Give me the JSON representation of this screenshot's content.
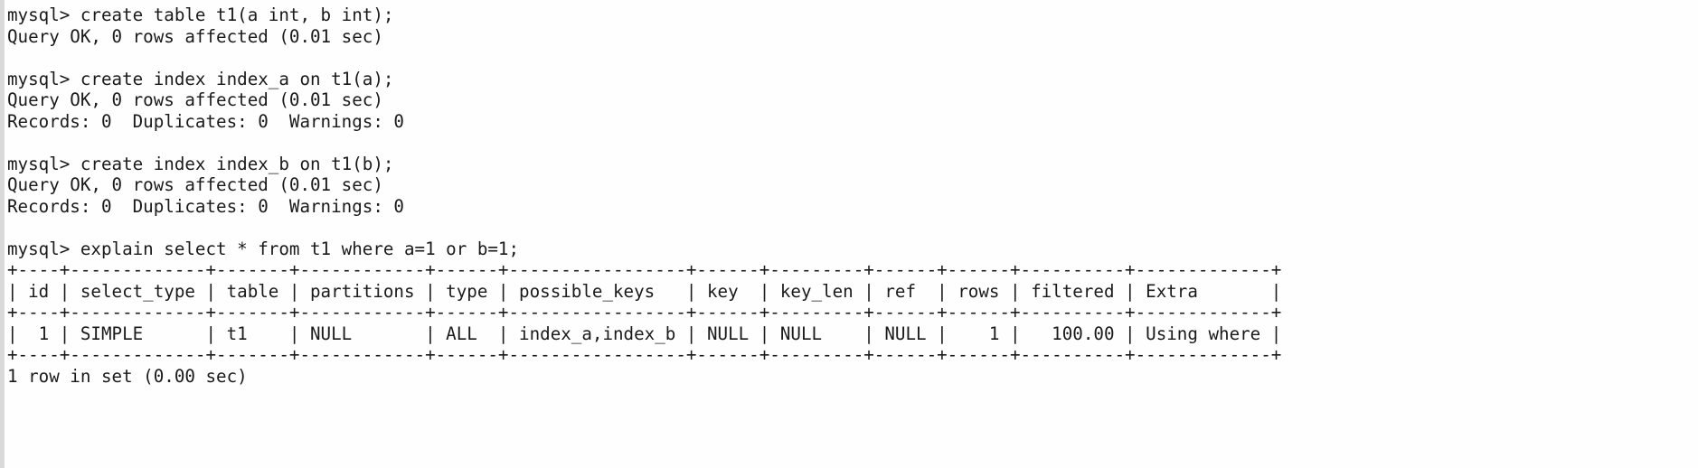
{
  "terminal": {
    "prompt": "mysql>",
    "background_color": "#fefefe",
    "text_color": "#1a1a1a",
    "gutter_color": "#d9d9d9",
    "blocks": [
      {
        "name": "create-table-block",
        "lines": [
          "mysql> create table t1(a int, b int);",
          "Query OK, 0 rows affected (0.01 sec)"
        ]
      },
      {
        "name": "create-index-a-block",
        "lines": [
          "mysql> create index index_a on t1(a);",
          "Query OK, 0 rows affected (0.01 sec)",
          "Records: 0  Duplicates: 0  Warnings: 0"
        ]
      },
      {
        "name": "create-index-b-block",
        "lines": [
          "mysql> create index index_b on t1(b);",
          "Query OK, 0 rows affected (0.01 sec)",
          "Records: 0  Duplicates: 0  Warnings: 0"
        ]
      },
      {
        "name": "explain-block",
        "lines": [
          "mysql> explain select * from t1 where a=1 or b=1;"
        ]
      }
    ],
    "explain_table": {
      "separator": "+----+-------------+-------+------------+------+---------------+------+---------+------+------+----------+-------------+",
      "header_row": "| id | select_type | table | partitions | type | possible_keys | key  | key_len | ref  | rows | filtered | Extra       |",
      "data_rows": [
        "|  1 | SIMPLE      | t1    | NULL       | ALL  | index_a,index_b | NULL | NULL    | NULL |    1 |   100.00 | Using where |"
      ],
      "columns": [
        "id",
        "select_type",
        "table",
        "partitions",
        "type",
        "possible_keys",
        "key",
        "key_len",
        "ref",
        "rows",
        "filtered",
        "Extra"
      ],
      "rows": [
        {
          "id": "1",
          "select_type": "SIMPLE",
          "table": "t1",
          "partitions": "NULL",
          "type": "ALL",
          "possible_keys": "index_a,index_b",
          "key": "NULL",
          "key_len": "NULL",
          "ref": "NULL",
          "rows": "1",
          "filtered": "100.00",
          "Extra": "Using where"
        }
      ]
    },
    "status_line": "1 row in set (0.00 sec)",
    "rendered": "mysql> create table t1(a int, b int);\nQuery OK, 0 rows affected (0.01 sec)\n\nmysql> create index index_a on t1(a);\nQuery OK, 0 rows affected (0.01 sec)\nRecords: 0  Duplicates: 0  Warnings: 0\n\nmysql> create index index_b on t1(b);\nQuery OK, 0 rows affected (0.01 sec)\nRecords: 0  Duplicates: 0  Warnings: 0\n\nmysql> explain select * from t1 where a=1 or b=1;\n+----+-------------+-------+------------+------+-----------------+------+---------+------+------+----------+-------------+\n| id | select_type | table | partitions | type | possible_keys   | key  | key_len | ref  | rows | filtered | Extra       |\n+----+-------------+-------+------------+------+-----------------+------+---------+------+------+----------+-------------+\n|  1 | SIMPLE      | t1    | NULL       | ALL  | index_a,index_b | NULL | NULL    | NULL |    1 |   100.00 | Using where |\n+----+-------------+-------+------------+------+-----------------+------+---------+------+------+----------+-------------+\n1 row in set (0.00 sec)"
  }
}
